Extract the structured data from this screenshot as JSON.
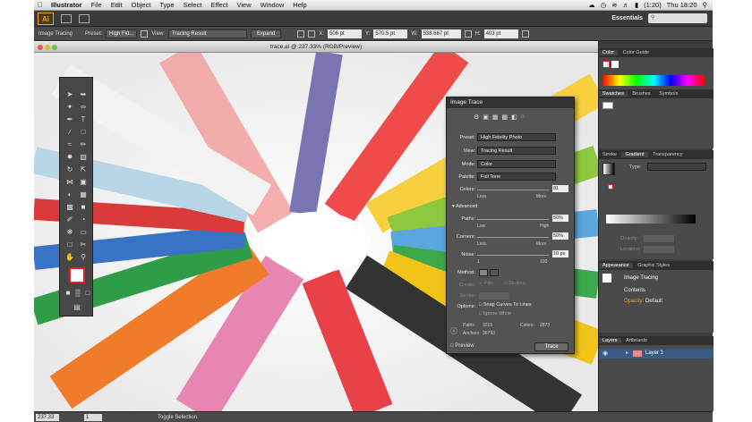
{
  "menubar": {
    "app": "Illustrator",
    "items": [
      "File",
      "Edit",
      "Object",
      "Type",
      "Select",
      "Effect",
      "View",
      "Window",
      "Help"
    ],
    "battery": "(1:20)",
    "clock": "Thu 18:20"
  },
  "appbar": {
    "logo": "Ai",
    "workspace": "Essentials"
  },
  "control": {
    "label": "Image Tracing",
    "preset_label": "Preset:",
    "preset": "High Fid...",
    "view_label": "View:",
    "view": "Tracing Result",
    "expand": "Expand",
    "x_label": "X:",
    "x": "506 pt",
    "y_label": "Y:",
    "y": "570.5 pt",
    "w_label": "W:",
    "w": "538.667 pt",
    "h_label": "H:",
    "h": "403 pt"
  },
  "document": {
    "title": "trace.ai @ 237.33% (RGB/Preview)"
  },
  "status": {
    "zoom": "237.33",
    "page": "1",
    "mode": "Toggle Selection"
  },
  "trace_panel": {
    "title": "Image Trace",
    "preset_label": "Preset:",
    "preset": "High Fidelity Photo",
    "view_label": "View:",
    "view": "Tracing Result",
    "mode_label": "Mode:",
    "mode": "Color",
    "palette_label": "Palette:",
    "palette": "Full Tone",
    "colors_label": "Colors:",
    "colors": "81",
    "less": "Less",
    "more": "More",
    "advanced": "Advanced",
    "paths_label": "Paths:",
    "paths": "50%",
    "low": "Low",
    "high": "High",
    "corners_label": "Corners:",
    "corners": "50%",
    "noise_label": "Noise:",
    "noise": "10 px",
    "noise_min": "1",
    "noise_max": "100",
    "method_label": "Method:",
    "create_label": "Create:",
    "fills": "Fills",
    "strokes": "Strokes",
    "stroke_label": "Stroke:",
    "options_label": "Options:",
    "snap": "Snap Curves To Lines",
    "ignore_white": "Ignore White",
    "paths_count_label": "Paths:",
    "paths_count": "3215",
    "colors_count_label": "Colors:",
    "colors_count": "2873",
    "anchors_label": "Anchors:",
    "anchors": "36793",
    "preview": "Preview",
    "trace_btn": "Trace"
  },
  "dock": {
    "color_tabs": [
      "Color",
      "Color Guide"
    ],
    "swatch_tabs": [
      "Swatches",
      "Brushes",
      "Symbols"
    ],
    "stroke_tabs": [
      "Stroke",
      "Gradient",
      "Transparency"
    ],
    "type_label": "Type:",
    "opacity_label": "Opacity:",
    "location_label": "Location:",
    "appearance_tabs": [
      "Appearance",
      "Graphic Styles"
    ],
    "appearance_title": "Image Tracing",
    "appearance_contents": "Contents",
    "appearance_opacity_label": "Opacity:",
    "appearance_opacity": "Default",
    "layers_tabs": [
      "Layers",
      "Artboards"
    ],
    "layer_name": "Layer 1"
  }
}
